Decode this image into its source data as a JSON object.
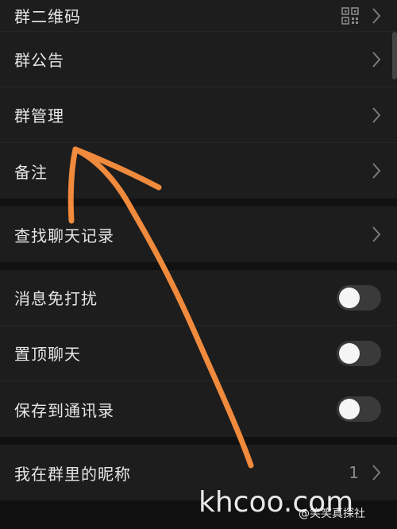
{
  "settings": {
    "group1": [
      {
        "label": "群二维码",
        "has_qr": true
      },
      {
        "label": "群公告"
      },
      {
        "label": "群管理"
      },
      {
        "label": "备注"
      }
    ],
    "search_history": {
      "label": "查找聊天记录"
    },
    "toggles": [
      {
        "label": "消息免打扰",
        "on": false
      },
      {
        "label": "置顶聊天",
        "on": false
      },
      {
        "label": "保存到通讯录",
        "on": false
      }
    ],
    "nickname": {
      "label": "我在群里的昵称",
      "value": "1"
    }
  },
  "annotation": {
    "color": "#f08a3c",
    "icon": "hand-drawn-arrow-icon"
  },
  "watermark": {
    "site": "khcoo.com",
    "handle": "@笑笑真探社"
  }
}
